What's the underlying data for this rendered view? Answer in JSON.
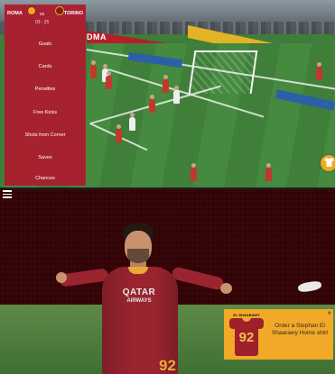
{
  "match": {
    "home_team": "ROMA",
    "away_team": "TORINO",
    "versus": "vs",
    "clock": "03 : 25"
  },
  "menu": {
    "items": [
      {
        "label": "Goals"
      },
      {
        "label": "Cards"
      },
      {
        "label": "Penalties"
      },
      {
        "label": "Free Kicks"
      },
      {
        "label": "Shots from Corner"
      },
      {
        "label": "Saves"
      },
      {
        "label": "Chances"
      }
    ]
  },
  "stadium": {
    "adboard_text": "DMA",
    "sponsor_main": "QATAR",
    "sponsor_sub": "AIRWAYS",
    "shirt_number": "92"
  },
  "promo": {
    "text": "Order a Stephan El Shaarawy Home shirt",
    "jersey_name": "EL SHAARAWY",
    "jersey_number": "92",
    "close_glyph": "×"
  },
  "icons": {
    "menu": "hamburger-icon",
    "shirt": "shirt-icon",
    "close": "close-icon"
  },
  "colors": {
    "menu_bg": "#ac1c2e",
    "promo_bg": "#f1a927",
    "shirt_button": "#f0a91e"
  }
}
